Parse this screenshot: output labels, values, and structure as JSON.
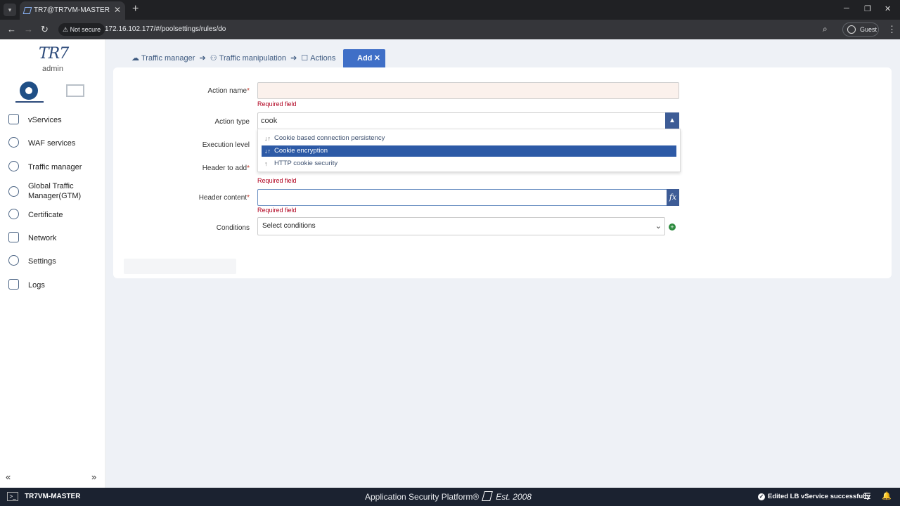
{
  "browser": {
    "tab_title": "TR7@TR7VM-MASTER",
    "security_chip": "Not secure",
    "url": "172.16.102.177/#/poolsettings/rules/do",
    "profile": "Guest"
  },
  "sidebar": {
    "logo": "TR7",
    "user": "admin",
    "items": [
      {
        "label": "vServices"
      },
      {
        "label": "WAF services"
      },
      {
        "label": "Traffic manager"
      },
      {
        "label": "Global Traffic Manager(GTM)"
      },
      {
        "label": "Certificate"
      },
      {
        "label": "Network"
      },
      {
        "label": "Settings"
      },
      {
        "label": "Logs"
      }
    ]
  },
  "breadcrumb": {
    "items": [
      "Traffic manager",
      "Traffic manipulation",
      "Actions"
    ],
    "active_tab": "Add"
  },
  "form": {
    "action_name": {
      "label": "Action name",
      "value": "",
      "error": "Required field"
    },
    "action_type": {
      "label": "Action type",
      "value": "cook"
    },
    "execution_level": {
      "label": "Execution level"
    },
    "header_to_add": {
      "label": "Header to add",
      "error": "Required field"
    },
    "header_content": {
      "label": "Header content",
      "value": "",
      "error": "Required field"
    },
    "conditions": {
      "label": "Conditions",
      "placeholder": "Select conditions"
    },
    "dropdown_options": [
      {
        "label": "Cookie based connection persistency",
        "selected": false
      },
      {
        "label": "Cookie encryption",
        "selected": true
      },
      {
        "label": "HTTP cookie security",
        "selected": false
      }
    ]
  },
  "footer": {
    "host": "TR7VM-MASTER",
    "product": "Application Security Platform®",
    "est": "Est. 2008",
    "status": "Edited LB vService successfully"
  },
  "colors": {
    "accent": "#3f6fc7",
    "select_blue": "#2d5aa6",
    "error_red": "#b0001e",
    "footer_bg": "#1b2230"
  }
}
